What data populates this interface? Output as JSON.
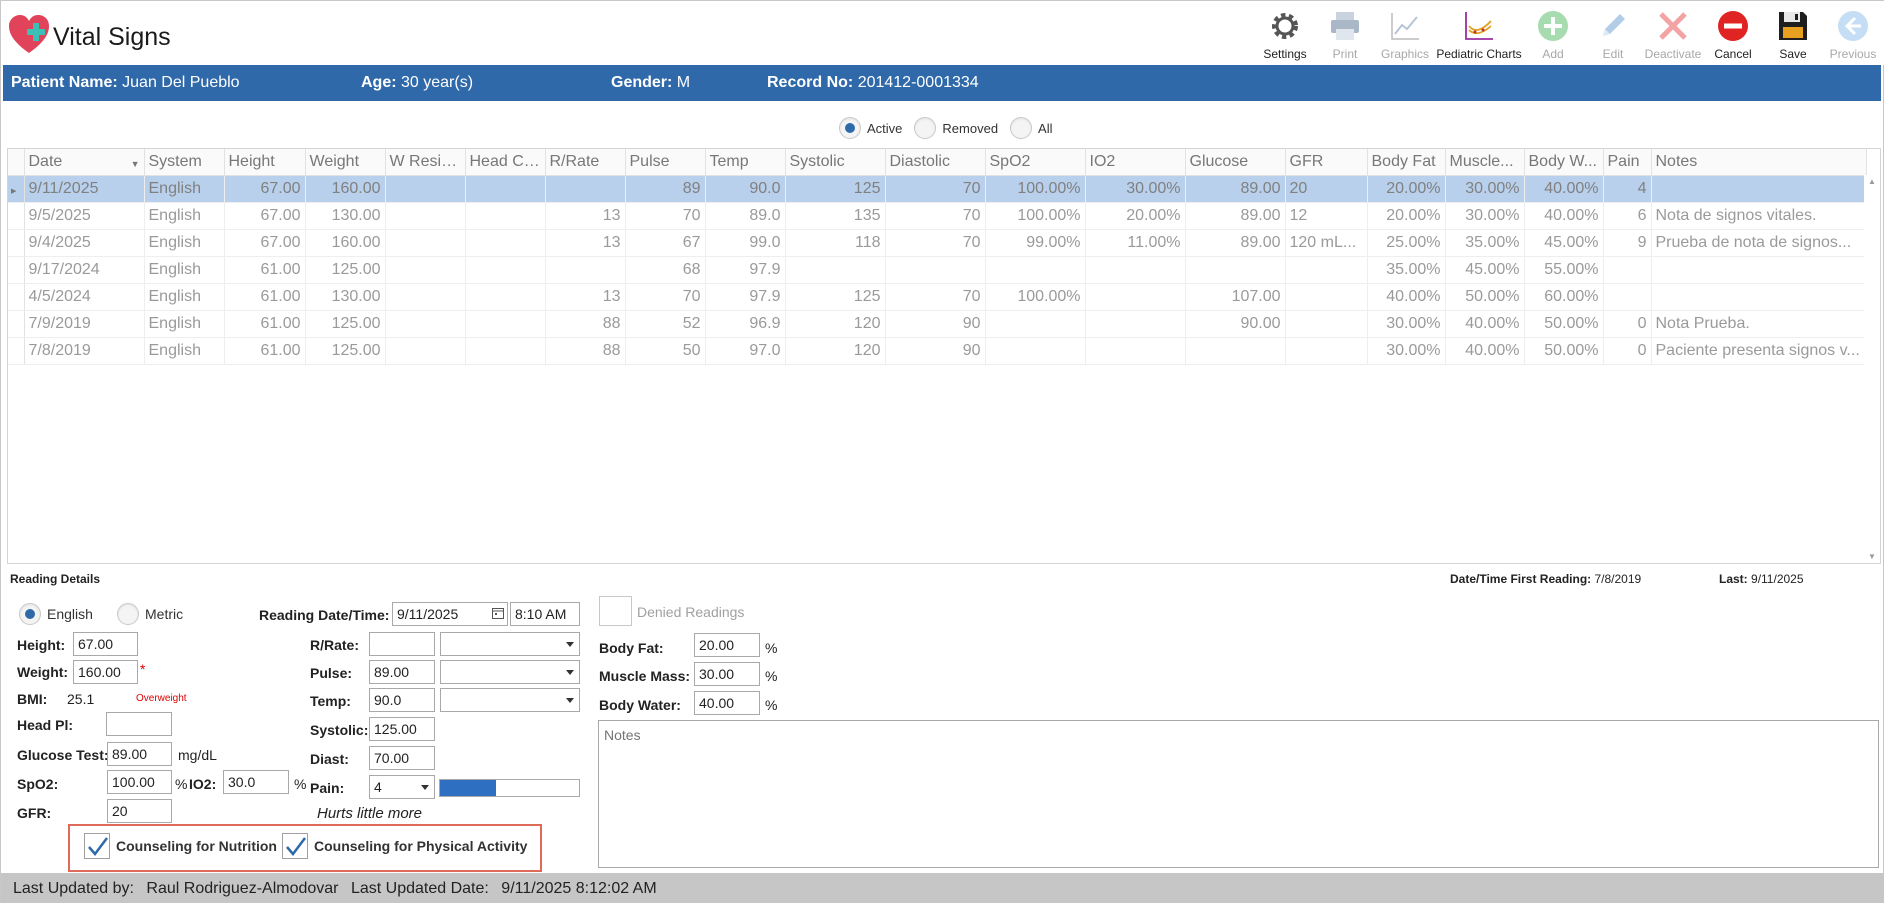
{
  "app": {
    "title": "Vital Signs"
  },
  "toolbar": [
    {
      "label": "Settings",
      "icon": "gear-icon",
      "enabled": true
    },
    {
      "label": "Print",
      "icon": "printer-icon",
      "enabled": false
    },
    {
      "label": "Graphics",
      "icon": "line-chart-icon",
      "enabled": false
    },
    {
      "label": "Pediatric Charts",
      "icon": "pediatric-chart-icon",
      "enabled": true
    },
    {
      "label": "Add",
      "icon": "plus-circle-icon",
      "enabled": false
    },
    {
      "label": "Edit",
      "icon": "pencil-icon",
      "enabled": false
    },
    {
      "label": "Deactivate",
      "icon": "x-icon",
      "enabled": false
    },
    {
      "label": "Cancel",
      "icon": "cancel-icon",
      "enabled": true
    },
    {
      "label": "Save",
      "icon": "floppy-disk-icon",
      "enabled": true
    },
    {
      "label": "Previous",
      "icon": "arrow-left-icon",
      "enabled": false
    }
  ],
  "patient": {
    "name_label": "Patient Name:",
    "name": "Juan Del Pueblo",
    "age_label": "Age:",
    "age": "30 year(s)",
    "gender_label": "Gender:",
    "gender": "M",
    "record_label": "Record No:",
    "record": "201412-0001334"
  },
  "filter": {
    "active": "Active",
    "removed": "Removed",
    "all": "All",
    "selected": "Active"
  },
  "grid": {
    "columns": [
      "Date",
      "System",
      "Height",
      "Weight",
      "W Resid...",
      "Head Circ.",
      "R/Rate",
      "Pulse",
      "Temp",
      "Systolic",
      "Diastolic",
      "SpO2",
      "IO2",
      "Glucose",
      "GFR",
      "Body Fat",
      "Muscle...",
      "Body W...",
      "Pain",
      "Notes"
    ],
    "rows": [
      [
        "9/11/2025",
        "English",
        "67.00",
        "160.00",
        "",
        "",
        "",
        "89",
        "90.0",
        "125",
        "70",
        "100.00%",
        "30.00%",
        "89.00",
        "20",
        "20.00%",
        "30.00%",
        "40.00%",
        "4",
        ""
      ],
      [
        "9/5/2025",
        "English",
        "67.00",
        "130.00",
        "",
        "",
        "13",
        "70",
        "89.0",
        "135",
        "70",
        "100.00%",
        "20.00%",
        "89.00",
        "12",
        "20.00%",
        "30.00%",
        "40.00%",
        "6",
        "Nota de signos vitales."
      ],
      [
        "9/4/2025",
        "English",
        "67.00",
        "160.00",
        "",
        "",
        "13",
        "67",
        "99.0",
        "118",
        "70",
        "99.00%",
        "11.00%",
        "89.00",
        "120 mL...",
        "25.00%",
        "35.00%",
        "45.00%",
        "9",
        "Prueba de nota de signos..."
      ],
      [
        "9/17/2024",
        "English",
        "61.00",
        "125.00",
        "",
        "",
        "",
        "68",
        "97.9",
        "",
        "",
        "",
        "",
        "",
        "",
        "35.00%",
        "45.00%",
        "55.00%",
        "",
        ""
      ],
      [
        "4/5/2024",
        "English",
        "61.00",
        "130.00",
        "",
        "",
        "13",
        "70",
        "97.9",
        "125",
        "70",
        "100.00%",
        "",
        "107.00",
        "",
        "40.00%",
        "50.00%",
        "60.00%",
        "",
        ""
      ],
      [
        "7/9/2019",
        "English",
        "61.00",
        "125.00",
        "",
        "",
        "88",
        "52",
        "96.9",
        "120",
        "90",
        "",
        "",
        "90.00",
        "",
        "30.00%",
        "40.00%",
        "50.00%",
        "0",
        "Nota Prueba."
      ],
      [
        "7/8/2019",
        "English",
        "61.00",
        "125.00",
        "",
        "",
        "88",
        "50",
        "97.0",
        "120",
        "90",
        "",
        "",
        "",
        "",
        "30.00%",
        "40.00%",
        "50.00%",
        "0",
        "Paciente presenta signos v..."
      ]
    ]
  },
  "details": {
    "section_label": "Reading Details",
    "first_reading_label": "Date/Time First Reading:",
    "first_reading": "7/8/2019",
    "last_label": "Last:",
    "last": "9/11/2025",
    "system_english": "English",
    "system_metric": "Metric",
    "system_selected": "English",
    "height_label": "Height:",
    "height": "67.00",
    "weight_label": "Weight:",
    "weight": "160.00",
    "required_mark": "*",
    "bmi_label": "BMI:",
    "bmi": "25.1",
    "bmi_status": "Overweight",
    "headpl_label": "Head Pl:",
    "headpl": "",
    "glucose_label": "Glucose Test:",
    "glucose": "89.00",
    "glucose_unit": "mg/dL",
    "spo2_label": "SpO2:",
    "spo2": "100.00",
    "percent": "%",
    "io2_label": "IO2:",
    "io2": "30.0",
    "gfr_label": "GFR:",
    "gfr": "20",
    "reading_dt_label": "Reading Date/Time:",
    "reading_date": "9/11/2025",
    "reading_time": "8:10 AM",
    "rrate_label": "R/Rate:",
    "rrate": "",
    "pulse_label": "Pulse:",
    "pulse": "89.00",
    "temp_label": "Temp:",
    "temp": "90.0",
    "systolic_label": "Systolic:",
    "systolic": "125.00",
    "diast_label": "Diast:",
    "diast": "70.00",
    "pain_label": "Pain:",
    "pain": "4",
    "pain_max": 10,
    "pain_text": "Hurts little more",
    "denied_label": "Denied Readings",
    "bodyfat_label": "Body Fat:",
    "bodyfat": "20.00",
    "muscle_label": "Muscle Mass:",
    "muscle": "30.00",
    "bodywater_label": "Body Water:",
    "bodywater": "40.00",
    "notes_placeholder": "Notes",
    "counsel_nutrition": "Counseling for Nutrition",
    "counsel_activity": "Counseling for Physical Activity"
  },
  "status": {
    "updated_by_label": "Last Updated by:",
    "updated_by": "Raul Rodriguez-Almodovar",
    "updated_date_label": "Last Updated Date:",
    "updated_date": "9/11/2025 8:12:02 AM"
  },
  "colors": {
    "accent": "#2f69a9",
    "selected_row": "#b8d0ec",
    "highlight_border": "#e06a5a"
  }
}
